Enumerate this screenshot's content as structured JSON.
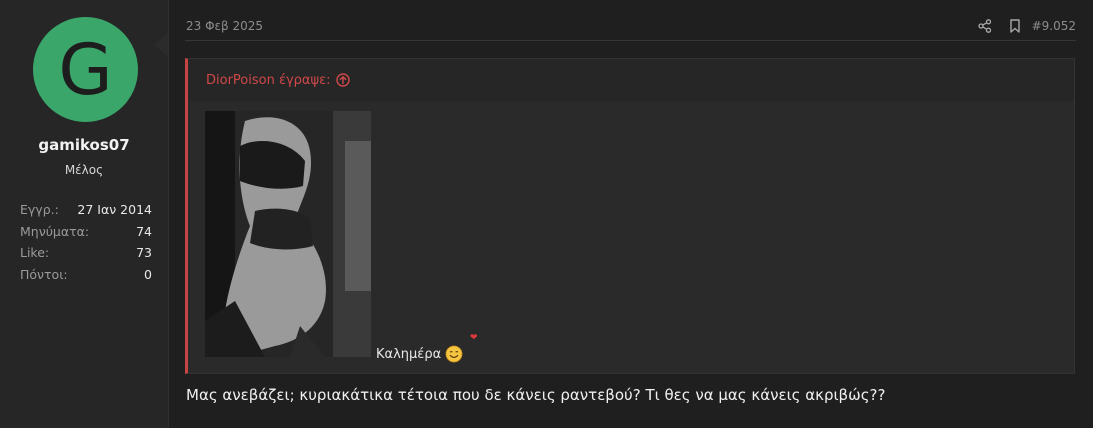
{
  "user": {
    "avatar_letter": "G",
    "avatar_color": "#3aa66a",
    "username": "gamikos07",
    "title": "Μέλος",
    "stats": [
      {
        "label": "Εγγρ.:",
        "value": "27 Ιαν 2014"
      },
      {
        "label": "Μηνύματα:",
        "value": "74"
      },
      {
        "label": "Like:",
        "value": "73"
      },
      {
        "label": "Πόντοι:",
        "value": "0"
      }
    ]
  },
  "post": {
    "date": "23 Φεβ 2025",
    "number": "#9.052",
    "actions": {
      "share_icon": "share-icon",
      "bookmark_icon": "bookmark-icon"
    },
    "quote": {
      "author_line": "DiorPoison έγραψε:",
      "accent_color": "#d04848",
      "caption": "Καλημέρα"
    },
    "message": "Μας ανεβάζει; κυριακάτικα τέτοια που δε κάνεις ραντεβού? Τι θες να μας κάνεις ακριβώς??"
  }
}
